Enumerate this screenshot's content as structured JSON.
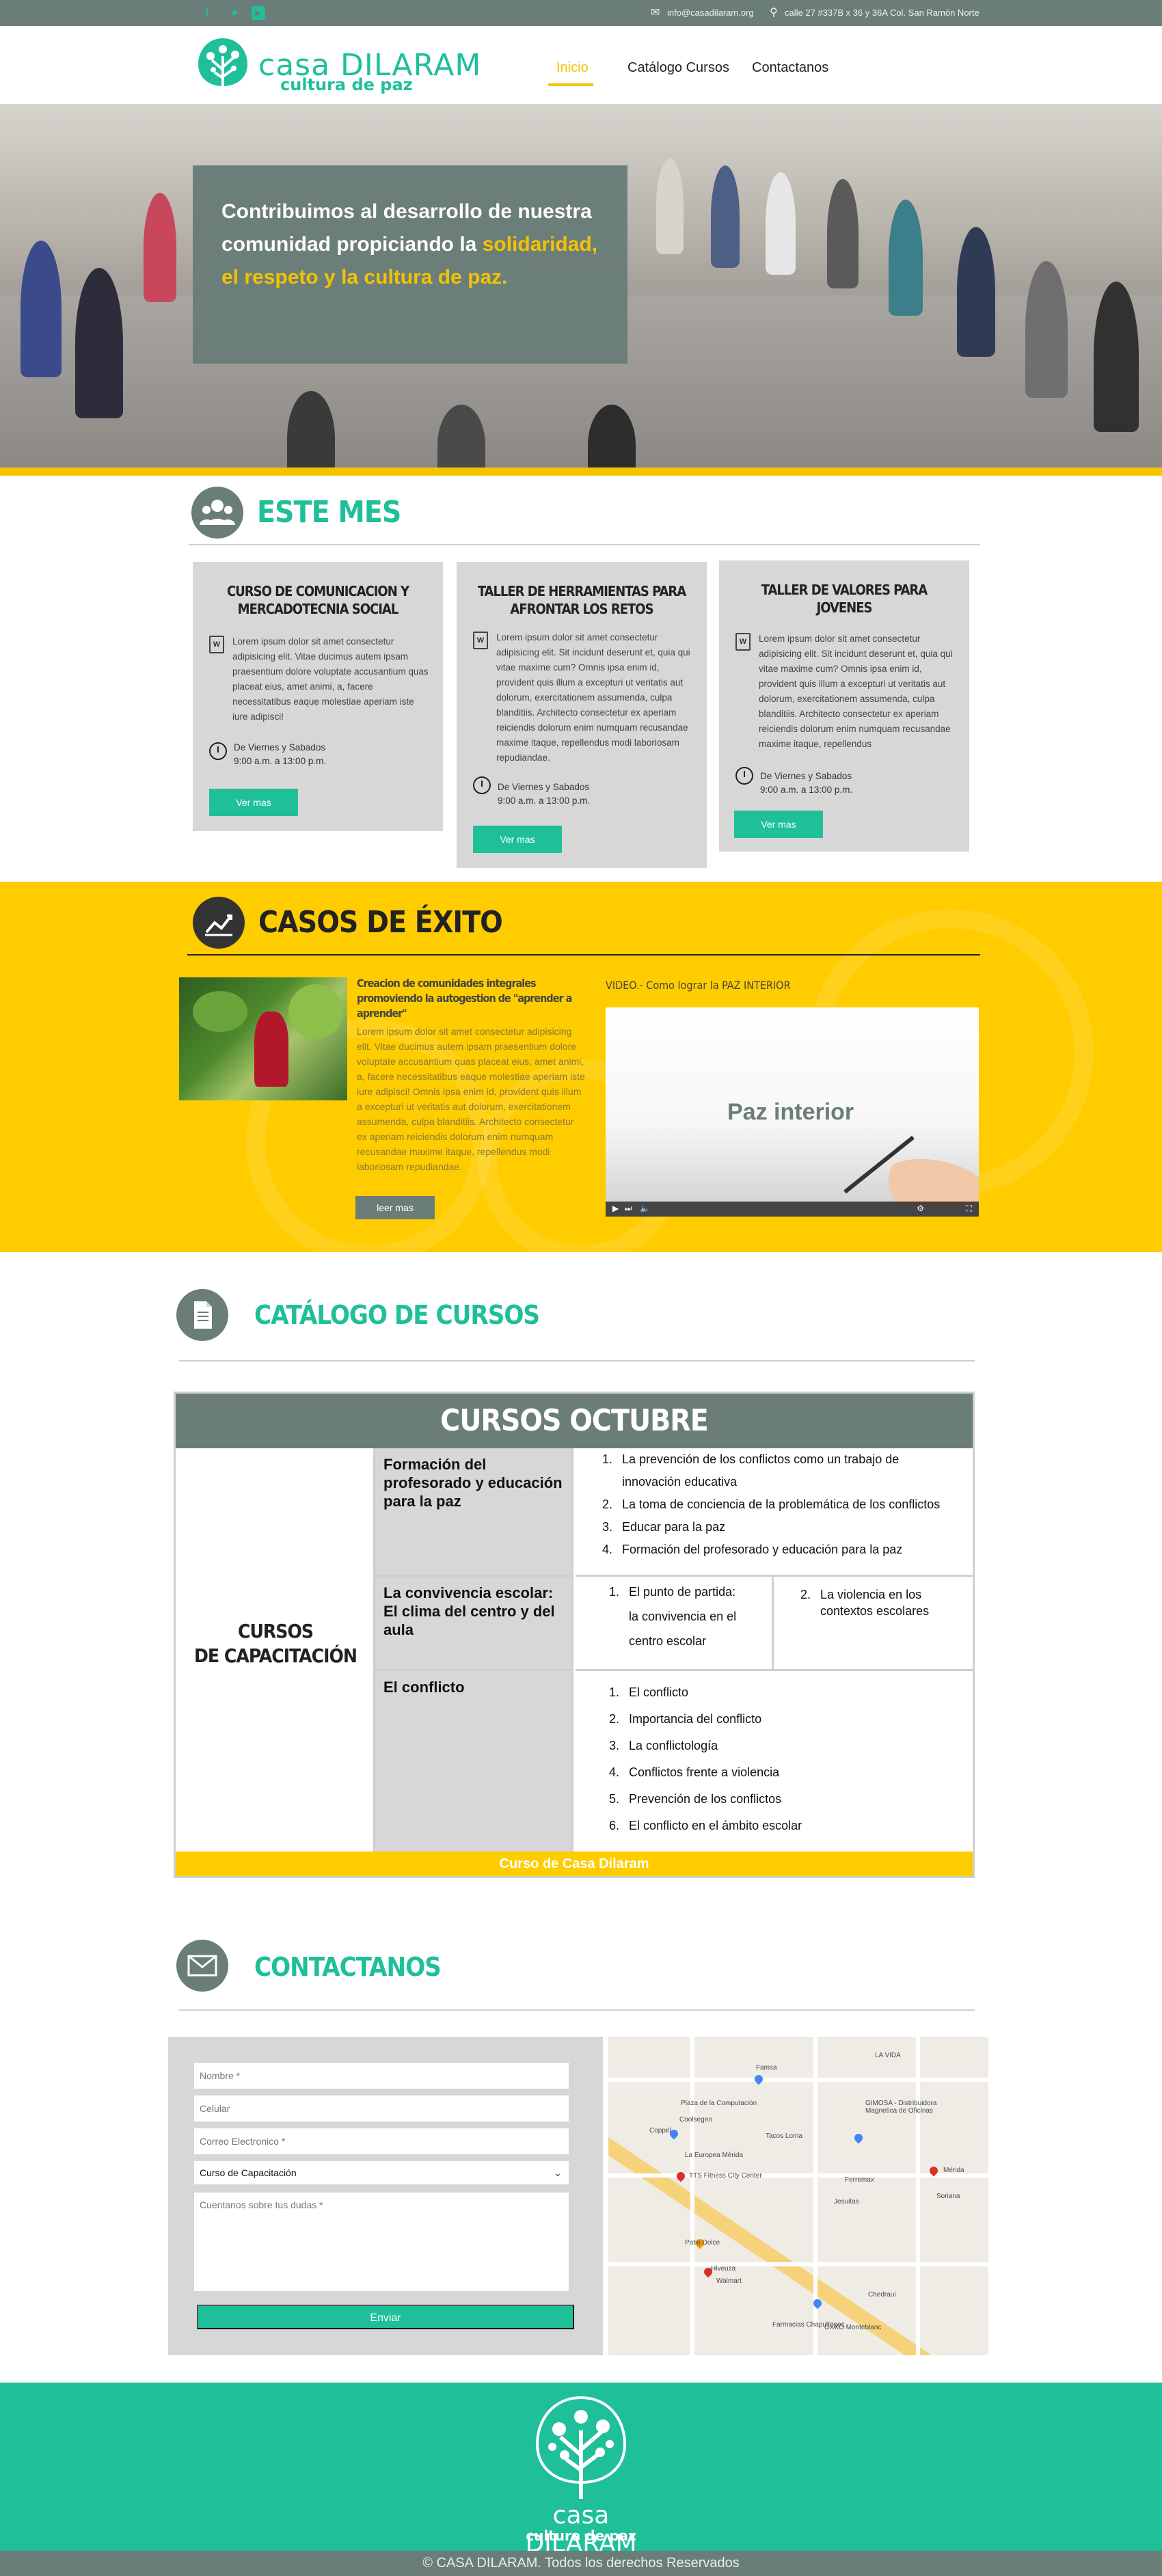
{
  "topbar": {
    "email": "info@casadilaram.org",
    "address": "calle 27 #337B  x 36 y 36A Col. San Ramón Norte"
  },
  "header": {
    "logo_name": "casa DILARAM",
    "logo_sub": "cultura de paz",
    "nav": [
      "Inicio",
      "Catálogo Cursos",
      "Contactanos"
    ]
  },
  "hero": {
    "line1": "Contribuimos al desarrollo de nuestra",
    "line2": "comunidad propiciando la ",
    "highlight1": "solidaridad,",
    "highlight2": "el respeto y la cultura de paz."
  },
  "este_mes": {
    "title": "ESTE MES",
    "cards": [
      {
        "title": "CURSO DE COMUNICACION Y MERCADOTECNIA SOCIAL",
        "body": "Lorem ipsum dolor sit amet consectetur adipisicing elit. Vitae ducimus autem ipsam praesentium dolore voluptate accusantium quas placeat eius, amet animi, a, facere necessitatibus eaque molestiae aperiam iste iure adipisci!",
        "days": "De Viernes y Sabados",
        "hours": "9:00 a.m.   a   13:00 p.m.",
        "button": "Ver mas"
      },
      {
        "title": "TALLER DE HERRAMIENTAS PARA AFRONTAR LOS RETOS",
        "body": "Lorem ipsum dolor sit amet consectetur adipisicing elit. Sit incidunt deserunt et, quia qui vitae maxime cum? Omnis ipsa enim id, provident quis illum a excepturi ut veritatis aut dolorum, exercitationem assumenda, culpa blanditiis. Architecto consectetur ex aperiam reiciendis dolorum enim numquam recusandae maxime itaque, repellendus modi laboriosam repudiandae.",
        "days": "De Viernes y Sabados",
        "hours": "9:00 a.m.   a   13:00 p.m.",
        "button": "Ver mas"
      },
      {
        "title": "TALLER DE VALORES PARA JOVENES",
        "body": "Lorem ipsum dolor sit amet consectetur adipisicing elit. Sit incidunt deserunt et, quia qui vitae maxime cum? Omnis ipsa enim id, provident quis illum a excepturi ut veritatis aut dolorum, exercitationem assumenda, culpa blanditiis. Architecto consectetur ex aperiam reiciendis dolorum enim numquam recusandae maxime itaque, repellendus",
        "days": "De Viernes y Sabados",
        "hours": "9:00 a.m.   a   13:00 p.m.",
        "button": "Ver mas"
      }
    ]
  },
  "casos": {
    "title": "CASOS DE ÉXITO",
    "story_title": "Creacion de comunidades integrales promoviendo la autogestion de \"aprender a aprender\"",
    "story_body": "Lorem ipsum dolor sit amet consectetur adipisicing elit. Vitae ducimus autem ipsam praesentium dolore voluptate accusantium quas placeat eius, amet animi, a, facere necessitatibus eaque molestiae aperiam iste iure adipisci! Omnis ipsa enim id, provident quis illum a excepturi ut veritatis aut dolorum, exercitationem assumenda, culpa blanditiis. Architecto consectetur ex aperiam reiciendis dolorum enim numquam recusandae maxime itaque, repellendus modi laboriosam repudiandae.",
    "button": "leer mas",
    "video_title": "VIDEO.- Como lograr la PAZ INTERIOR",
    "video_text": "Paz interior"
  },
  "catalogo": {
    "title": "CATÁLOGO DE CURSOS",
    "table_title": "CURSOS OCTUBRE",
    "left_label_1": "CURSOS",
    "left_label_2": "DE CAPACITACIÓN",
    "rows": [
      {
        "topic": "Formación del profesorado y educación para la paz",
        "items": [
          "La prevención de los conflictos como un trabajo de",
          "innovación educativa",
          "La toma de conciencia de la problemática de los conflictos",
          "Educar para la paz",
          "Formación del profesorado y educación para la paz"
        ]
      },
      {
        "topic": "La convivencia escolar: El clima del centro y del aula",
        "items_a": [
          "El punto de partida:",
          "la convivencia en el",
          "centro escolar"
        ],
        "items_b": [
          "La violencia en los",
          "contextos escolares"
        ]
      },
      {
        "topic": "El conflicto",
        "items": [
          "El conflicto",
          "Importancia del conflicto",
          "La conflictología",
          "Conflictos frente a violencia",
          "Prevención de los conflictos",
          "El conflicto en el ámbito escolar"
        ]
      }
    ],
    "footer": "Curso de Casa Dilaram"
  },
  "contacto": {
    "title": "CONTACTANOS",
    "placeholders": {
      "nombre": "Nombre *",
      "celular": "Celular",
      "correo": "Correo Electronico *",
      "dudas": "Cuentanos sobre tus dudas *"
    },
    "select_value": "Curso de Capacitación",
    "button": "Enviar",
    "map_labels": [
      "Plaza de la Computación",
      "Coppel",
      "Coolsegen",
      "La Europea Mérida",
      "TTS Fitness City Center",
      "Patio Dolce",
      "Hiveuza",
      "Walmart",
      "Farmacias Chapultepec",
      "Chedraui",
      "Mérida",
      "Soriana",
      "LA VIDA",
      "Famsa",
      "GIMOSA - Distribuidora Magnetica de Oficinas",
      "Ferremax",
      "Jesuitas",
      "Tacos Loma",
      "OXXO Monteblanc"
    ]
  },
  "footer": {
    "name": "casa DILARAM",
    "sub": "cultura de paz",
    "copyright": "© CASA DILARAM. Todos los derechos Reservados"
  },
  "colors": {
    "accent_green": "#1fbf9a",
    "slate": "#6a7d79",
    "yellow": "#ffcc00",
    "card_gray": "#d7d7d7"
  }
}
